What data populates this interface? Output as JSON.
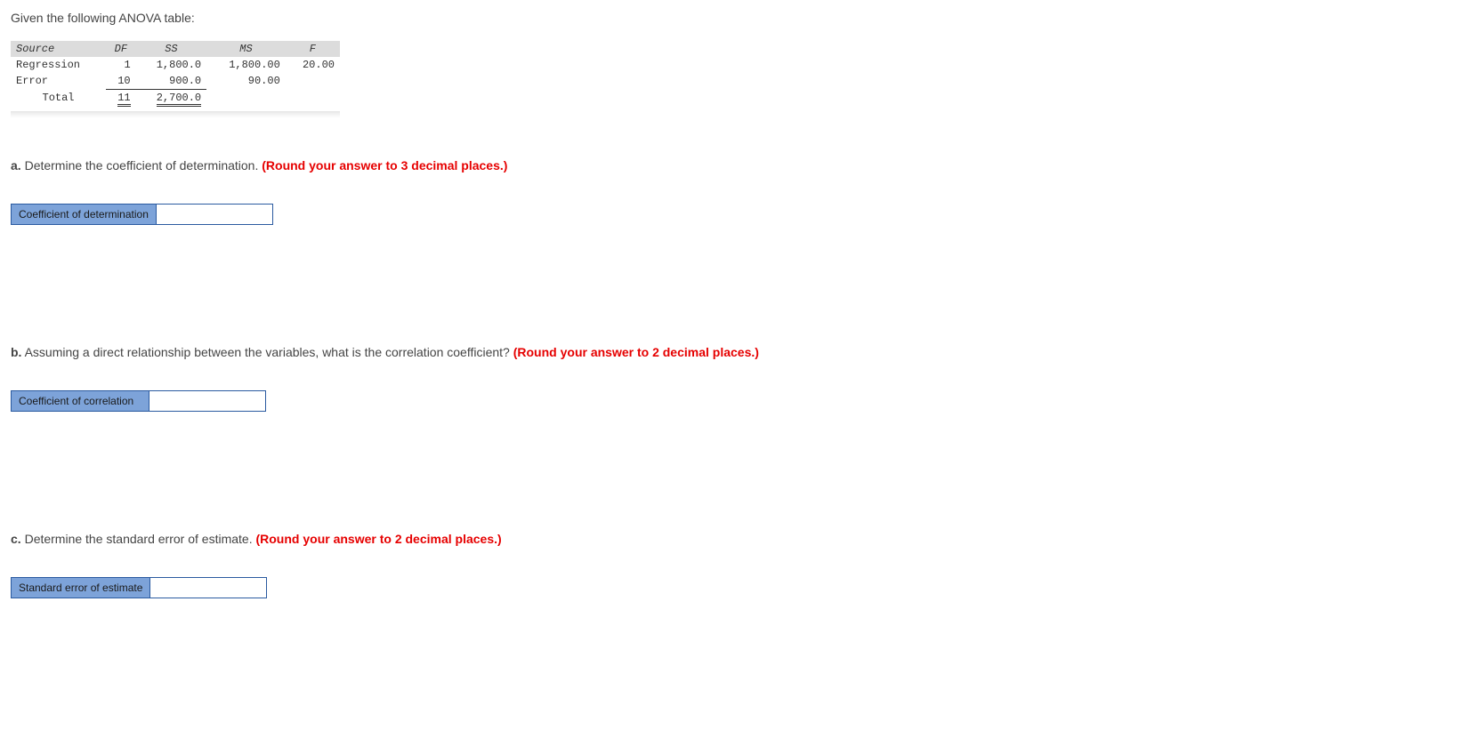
{
  "intro": "Given the following ANOVA table:",
  "anova": {
    "headers": [
      "Source",
      "DF",
      "SS",
      "MS",
      "F"
    ],
    "rows": [
      {
        "source": "Regression",
        "df": "1",
        "ss": "1,800.0",
        "ms": "1,800.00",
        "f": "20.00"
      },
      {
        "source": "Error",
        "df": "10",
        "ss": "900.0",
        "ms": "90.00",
        "f": ""
      }
    ],
    "total": {
      "source": "Total",
      "df": "11",
      "ss": "2,700.0",
      "ms": "",
      "f": ""
    }
  },
  "questions": {
    "a": {
      "prefix": "a.",
      "text": " Determine the coefficient of determination. ",
      "hint": "(Round your answer to 3 decimal places.)",
      "label": "Coefficient of determination"
    },
    "b": {
      "prefix": "b.",
      "text": " Assuming a direct relationship between the variables, what is the correlation coefficient? ",
      "hint": "(Round your answer to 2 decimal places.)",
      "label": "Coefficient of correlation"
    },
    "c": {
      "prefix": "c.",
      "text": " Determine the standard error of estimate. ",
      "hint": "(Round your answer to 2 decimal places.)",
      "label": "Standard error of estimate"
    }
  }
}
